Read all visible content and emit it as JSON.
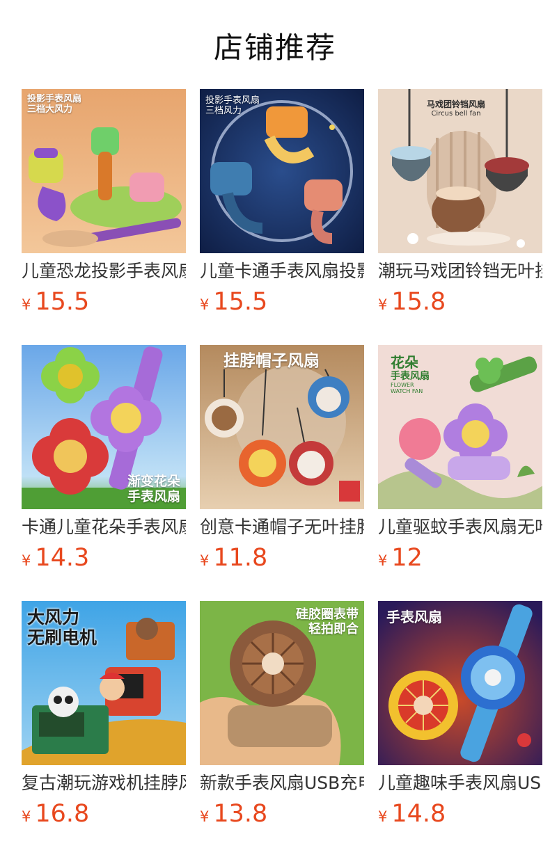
{
  "header": {
    "title": "店铺推荐"
  },
  "currency": "¥",
  "products": [
    {
      "title": "儿童恐龙投影手表风扇",
      "price": "15.5",
      "overlay": [
        "投影手表风扇",
        "三档大风力"
      ]
    },
    {
      "title": "儿童卡通手表风扇投影",
      "price": "15.5",
      "overlay": [
        "投影手表风扇",
        "三档风力"
      ]
    },
    {
      "title": "潮玩马戏团铃铛无叶挂脖风扇",
      "price": "15.8",
      "overlay": [
        "马戏团铃铛风扇",
        "Circus bell fan"
      ]
    },
    {
      "title": "卡通儿童花朵手表风扇",
      "price": "14.3",
      "overlay": [
        "渐变花朵",
        "手表风扇"
      ]
    },
    {
      "title": "创意卡通帽子无叶挂脖风扇",
      "price": "11.8",
      "overlay": [
        "挂脖帽子风扇"
      ]
    },
    {
      "title": "儿童驱蚊手表风扇无叶",
      "price": "12",
      "overlay": [
        "花朵",
        "手表风扇",
        "FLOWER",
        "WATCH FAN"
      ]
    },
    {
      "title": "复古潮玩游戏机挂脖风扇",
      "price": "16.8",
      "overlay": [
        "大风力",
        "无刷电机"
      ]
    },
    {
      "title": "新款手表风扇USB充电",
      "price": "13.8",
      "overlay": [
        "硅胶圈表带",
        "轻拍即合"
      ]
    },
    {
      "title": "儿童趣味手表风扇USB",
      "price": "14.8",
      "overlay": [
        "手表风扇"
      ]
    }
  ]
}
